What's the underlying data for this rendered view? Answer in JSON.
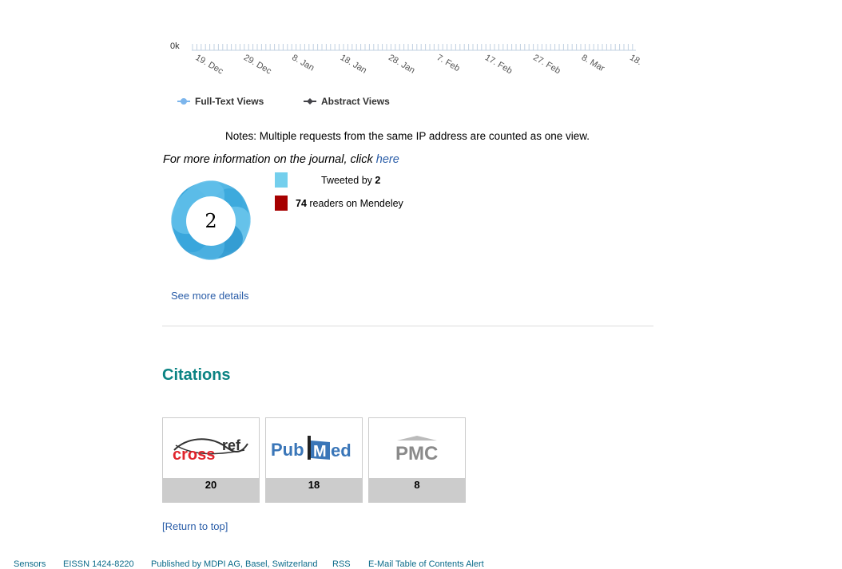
{
  "views_chart": {
    "y_label": "0k",
    "date_ticks": [
      "19. Dec",
      "29. Dec",
      "8. Jan",
      "18. Jan",
      "28. Jan",
      "7. Feb",
      "17. Feb",
      "27. Feb",
      "8. Mar",
      "18."
    ],
    "legend": [
      {
        "label": "Full-Text Views",
        "color": "#7cb5ec"
      },
      {
        "label": "Abstract Views",
        "color": "#434348"
      }
    ]
  },
  "notes": "Notes: Multiple requests from the same IP address are counted as one view.",
  "more_info": {
    "prefix": "For more information on the journal, click ",
    "link": "here"
  },
  "altmetric": {
    "score": "2",
    "tweets": {
      "prefix": "Tweeted by ",
      "count": "2",
      "color": "#74cfed"
    },
    "mendeley": {
      "count": "74",
      "suffix": " readers on Mendeley",
      "color": "#a60000"
    },
    "see_more": "See more details"
  },
  "citations": {
    "title": "Citations",
    "sources": [
      {
        "name": "crossref",
        "count": "20"
      },
      {
        "name": "PubMed",
        "count": "18"
      },
      {
        "name": "PMC",
        "count": "8"
      }
    ]
  },
  "return_top": "[Return to top]",
  "footer": {
    "links": [
      "Sensors",
      "EISSN 1424-8220",
      "Published by MDPI AG, Basel, Switzerland",
      "RSS",
      "E-Mail Table of Contents Alert"
    ]
  }
}
